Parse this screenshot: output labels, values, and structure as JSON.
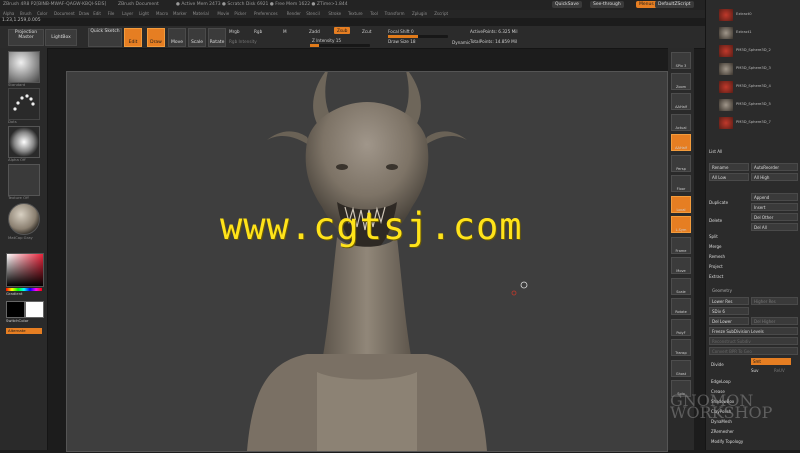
{
  "window": {
    "app_title": "ZBrush 4R8 P2[BINB-MWAF-QAGW-KBQI-SEIS]",
    "document_title": "ZBrush Document",
    "mem_info": "● Active Mem 2473 ● Scratch Disk 6921 ● Free Mem 1622 ● ZTime>1.844",
    "quicksave": "QuickSave",
    "see_through": "See-through",
    "menus_label": "Menus",
    "default_zscript": "DefaultZScript"
  },
  "menubar": [
    "Alpha",
    "Brush",
    "Color",
    "Document",
    "Draw",
    "Edit",
    "File",
    "Layer",
    "Light",
    "Macro",
    "Marker",
    "Material",
    "Movie",
    "Picker",
    "Preferences",
    "Render",
    "Stencil",
    "Stroke",
    "Texture",
    "Tool",
    "Transform",
    "Zplugin",
    "Zscript"
  ],
  "coords": "1.23,1.259,0.005",
  "shelf": {
    "projection_master": "Projection Master",
    "lightbox": "LightBox",
    "quick_sketch": "Quick Sketch",
    "edit": "Edit",
    "draw": "Draw",
    "move": "Move",
    "scale": "Scale",
    "rotate": "Rotate",
    "mrgb": "Mrgb",
    "rgb": "Rgb",
    "m": "M",
    "rgb_intensity": "Rgb Intensity",
    "zadd": "Zadd",
    "zsub": "Zsub",
    "zcut": "Zcut",
    "z_intensity": "Z Intensity 15",
    "z_intensity_level": 0.15,
    "focal_shift": "Focal Shift 0",
    "draw_size": "Draw Size 18",
    "dynamic": "Dynamic",
    "active_points": "ActivePoints: 6.325 Mil",
    "total_points": "TotalPoints: 14.859 Mil"
  },
  "left": {
    "brush_label": "Standard",
    "stroke_label": "Dots",
    "alpha_label": "Alpha Off",
    "texture_label": "Texture Off",
    "material_label": "MatCap Gray",
    "gradient": "Gradient",
    "switch_color": "SwitchColor",
    "alternate": "Alternate"
  },
  "right_shelf": [
    "SPix 3",
    "Zoom",
    "AAHalf",
    "Actual",
    "AAHalf",
    "Persp",
    "Floor",
    "Local",
    "L.Sym",
    "Frame",
    "Move",
    "Scale",
    "Rotate",
    "PolyF",
    "Transp",
    "Ghost",
    "Solo"
  ],
  "subtools": [
    "Extract0",
    "Extract1",
    "PM3D_Sphere3D_2",
    "PM3D_Sphere3D_3",
    "PM3D_Sphere3D_4",
    "PM3D_Sphere3D_5",
    "PM3D_Sphere3D_7"
  ],
  "panel": {
    "list_all": "List All",
    "rename": "Rename",
    "autoreorder": "AutoReorder",
    "all_low": "All Low",
    "all_high": "All High",
    "append": "Append",
    "duplicate": "Duplicate",
    "insert": "Insert",
    "delete": "Delete",
    "del_other": "Del Other",
    "del_all": "Del All",
    "split": "Split",
    "merge": "Merge",
    "remesh": "Remesh",
    "project": "Project",
    "extract": "Extract",
    "geometry": "Geometry",
    "lower_res": "Lower Res",
    "higher_res": "Higher Res",
    "sdiv": "SDiv 6",
    "del_lower": "Del Lower",
    "del_higher": "Del Higher",
    "freeze_sub": "Freeze SubDivision Levels",
    "reconstruct": "Reconstruct Subdiv",
    "convert_bpr": "Convert BPR To Geo",
    "divide": "Divide",
    "smt": "Smt",
    "suv": "Suv",
    "reuv": "ReUV",
    "edgeloop": "EdgeLoop",
    "crease": "Crease",
    "shadowbox": "ShadowBox",
    "claypolish": "ClayPolish",
    "dynamesh": "DynaMesh",
    "zremesher": "ZRemesher",
    "modify_topology": "Modify Topology"
  },
  "watermark": "www.cgtsj.com",
  "corner_logo": "GNOMON WORKSHOP",
  "colors": {
    "accent": "#e67e22",
    "watermark": "#ffe31a",
    "model": "#8a7f70"
  }
}
